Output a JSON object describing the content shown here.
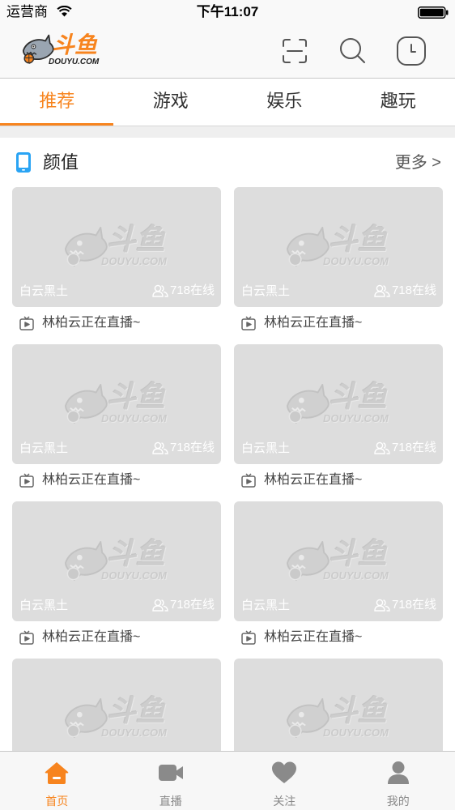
{
  "status_bar": {
    "carrier": "运营商",
    "time": "下午11:07",
    "icons": [
      "wifi-icon",
      "battery-icon"
    ]
  },
  "nav": {
    "logo": {
      "text": "斗鱼",
      "domain": "DOUYU.COM",
      "icon": "shark-mascot-icon"
    },
    "actions": [
      {
        "icon": "scan-icon"
      },
      {
        "icon": "search-icon"
      },
      {
        "icon": "history-clock-icon"
      }
    ]
  },
  "tabs": {
    "active": 0,
    "items": [
      {
        "label": "推荐"
      },
      {
        "label": "游戏"
      },
      {
        "label": "娱乐"
      },
      {
        "label": "趣玩"
      }
    ]
  },
  "section": {
    "icon": "phone-icon",
    "title": "颜值",
    "more": "更多 >",
    "cards": [
      {
        "name": "白云黑土",
        "online": "718在线",
        "caption": "林柏云正在直播~"
      },
      {
        "name": "白云黑土",
        "online": "718在线",
        "caption": "林柏云正在直播~"
      },
      {
        "name": "白云黑土",
        "online": "718在线",
        "caption": "林柏云正在直播~"
      },
      {
        "name": "白云黑土",
        "online": "718在线",
        "caption": "林柏云正在直播~"
      },
      {
        "name": "白云黑土",
        "online": "718在线",
        "caption": "林柏云正在直播~"
      },
      {
        "name": "白云黑土",
        "online": "718在线",
        "caption": "林柏云正在直播~"
      },
      {},
      {}
    ]
  },
  "placeholder": {
    "text": "斗鱼",
    "domain": "DOUYU.COM",
    "icon": "shark-mascot-icon"
  },
  "bottom_tabs": {
    "active": 0,
    "items": [
      {
        "label": "首页",
        "icon": "home-icon"
      },
      {
        "label": "直播",
        "icon": "video-camera-icon"
      },
      {
        "label": "关注",
        "icon": "heart-icon"
      },
      {
        "label": "我的",
        "icon": "person-icon"
      }
    ]
  },
  "colors": {
    "accent": "#f7841e",
    "text": "#333333",
    "inactive": "#8a8a8a",
    "section_icon": "#2aa4f4",
    "cover": "#dddddd"
  }
}
